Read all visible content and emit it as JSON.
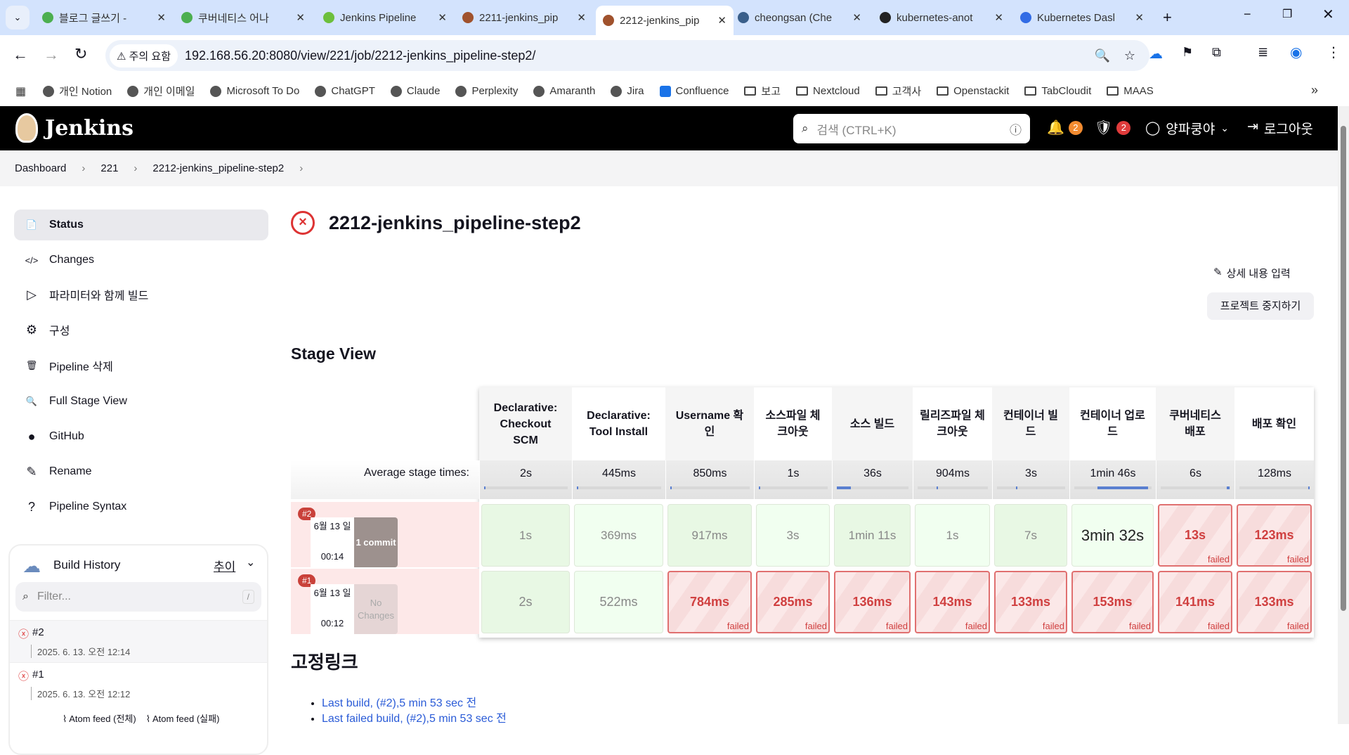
{
  "browser": {
    "tabs": [
      {
        "title": "블로그 글쓰기 -",
        "color": "#4caf50"
      },
      {
        "title": "쿠버네티스 어나",
        "color": "#4caf50"
      },
      {
        "title": "Jenkins Pipeline",
        "color": "#6cbf3c"
      },
      {
        "title": "2211-jenkins_pip",
        "color": "#a0522d"
      },
      {
        "title": "2212-jenkins_pip",
        "color": "#a0522d",
        "active": true
      },
      {
        "title": "cheongsan (Che",
        "color": "#3a5f8a"
      },
      {
        "title": "kubernetes-anot",
        "color": "#222222"
      },
      {
        "title": "Kubernetes Dasl",
        "color": "#326ce5"
      }
    ],
    "warning": "주의 요함",
    "url": "192.168.56.20:8080/view/221/job/2212-jenkins_pipeline-step2/",
    "bookmarks": [
      "개인 Notion",
      "개인 이메일",
      "Microsoft To Do",
      "ChatGPT",
      "Claude",
      "Perplexity",
      "Amaranth",
      "Jira",
      "Confluence"
    ],
    "folders": [
      "보고",
      "Nextcloud",
      "고객사",
      "Openstackit",
      "TabCloudit",
      "MAAS"
    ]
  },
  "header": {
    "brand": "Jenkins",
    "search_placeholder": "검색 (CTRL+K)",
    "notifications": "2",
    "security": "2",
    "user": "양파쿵야",
    "logout": "로그아웃"
  },
  "breadcrumb": [
    "Dashboard",
    "221",
    "2212-jenkins_pipeline-step2"
  ],
  "sidebar": {
    "items": [
      {
        "label": "Status",
        "icon": "📄"
      },
      {
        "label": "Changes",
        "icon": "</>"
      },
      {
        "label": "파라미터와 함께 빌드",
        "icon": "▷"
      },
      {
        "label": "구성",
        "icon": "⚙"
      },
      {
        "label": "Pipeline 삭제",
        "icon": "🗑"
      },
      {
        "label": "Full Stage View",
        "icon": "🔍"
      },
      {
        "label": "GitHub",
        "icon": "●"
      },
      {
        "label": "Rename",
        "icon": "✎"
      },
      {
        "label": "Pipeline Syntax",
        "icon": "?"
      }
    ]
  },
  "build_history": {
    "title": "Build History",
    "trend": "추이",
    "filter_placeholder": "Filter...",
    "shortcut": "/",
    "builds": [
      {
        "number": "#2",
        "date": "2025. 6. 13. 오전 12:14"
      },
      {
        "number": "#1",
        "date": "2025. 6. 13. 오전 12:12"
      }
    ],
    "feeds": [
      "Atom feed (전체)",
      "Atom feed (실패)"
    ]
  },
  "job": {
    "title": "2212-jenkins_pipeline-step2",
    "edit_description": "상세 내용 입력",
    "disable": "프로젝트 중지하기"
  },
  "stage_view": {
    "title": "Stage View",
    "avg_label": "Average stage times:",
    "stages": [
      {
        "name": "Declarative: Checkout SCM",
        "avg": "2s",
        "bar": [
          0.0,
          0.01
        ]
      },
      {
        "name": "Declarative: Tool Install",
        "avg": "445ms",
        "bar": [
          0.0,
          0.01
        ]
      },
      {
        "name": "Username 확인",
        "avg": "850ms",
        "bar": [
          0.0,
          0.01
        ]
      },
      {
        "name": "소스파일 체크아웃",
        "avg": "1s",
        "bar": [
          0.0,
          0.01
        ]
      },
      {
        "name": "소스 빌드",
        "avg": "36s",
        "bar": [
          0.0,
          0.2
        ]
      },
      {
        "name": "릴리즈파일 체크아웃",
        "avg": "904ms",
        "bar": [
          0.27,
          0.01
        ]
      },
      {
        "name": "컨테이너 빌드",
        "avg": "3s",
        "bar": [
          0.28,
          0.02
        ]
      },
      {
        "name": "컨테이너 업로드",
        "avg": "1min 46s",
        "bar": [
          0.3,
          0.65
        ]
      },
      {
        "name": "쿠버네티스 배포",
        "avg": "6s",
        "bar": [
          0.95,
          0.04
        ]
      },
      {
        "name": "배포 확인",
        "avg": "128ms",
        "bar": [
          0.98,
          0.01
        ]
      }
    ],
    "runs": [
      {
        "badge": "#2",
        "date": "6월 13 일",
        "time": "00:14",
        "changes": "1 commit",
        "cells": [
          {
            "t": "1s",
            "s": "ok"
          },
          {
            "t": "369ms",
            "s": "ok2"
          },
          {
            "t": "917ms",
            "s": "ok"
          },
          {
            "t": "3s",
            "s": "ok2"
          },
          {
            "t": "1min 11s",
            "s": "ok"
          },
          {
            "t": "1s",
            "s": "ok2"
          },
          {
            "t": "7s",
            "s": "ok"
          },
          {
            "t": "3min 32s",
            "s": "ok2",
            "dark": true
          },
          {
            "t": "13s",
            "s": "fail"
          },
          {
            "t": "123ms",
            "s": "fail"
          }
        ]
      },
      {
        "badge": "#1",
        "date": "6월 13 일",
        "time": "00:12",
        "changes": "No Changes",
        "cells": [
          {
            "t": "2s",
            "s": "ok"
          },
          {
            "t": "522ms",
            "s": "ok2"
          },
          {
            "t": "784ms",
            "s": "fail"
          },
          {
            "t": "285ms",
            "s": "fail"
          },
          {
            "t": "136ms",
            "s": "fail"
          },
          {
            "t": "143ms",
            "s": "fail"
          },
          {
            "t": "133ms",
            "s": "fail"
          },
          {
            "t": "153ms",
            "s": "fail"
          },
          {
            "t": "141ms",
            "s": "fail"
          },
          {
            "t": "133ms",
            "s": "fail"
          }
        ]
      }
    ],
    "failed_label": "failed"
  },
  "permalinks": {
    "title": "고정링크",
    "links": [
      "Last build, (#2),5 min 53 sec 전",
      "Last failed build, (#2),5 min 53 sec 전"
    ]
  }
}
